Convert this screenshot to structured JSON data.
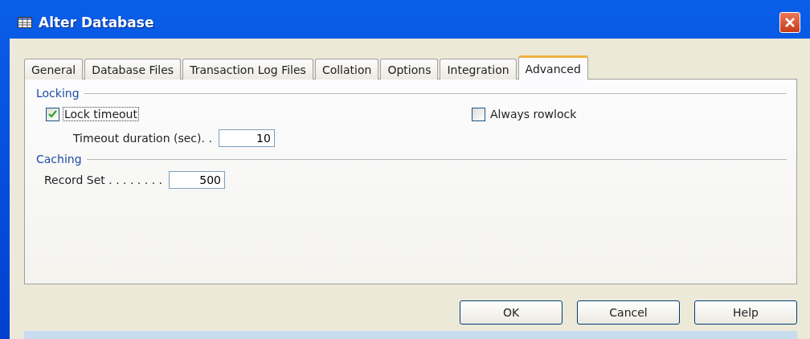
{
  "window": {
    "title": "Alter Database"
  },
  "tabs": [
    {
      "label": "General",
      "selected": false
    },
    {
      "label": "Database Files",
      "selected": false
    },
    {
      "label": "Transaction Log Files",
      "selected": false
    },
    {
      "label": "Collation",
      "selected": false
    },
    {
      "label": "Options",
      "selected": false
    },
    {
      "label": "Integration",
      "selected": false
    },
    {
      "label": "Advanced",
      "selected": true
    }
  ],
  "locking": {
    "heading": "Locking",
    "lock_timeout": {
      "label": "Lock timeout",
      "checked": true
    },
    "always_rowlock": {
      "label": "Always rowlock",
      "checked": false
    },
    "timeout_duration": {
      "label": "Timeout duration (sec). .",
      "value": "10"
    }
  },
  "caching": {
    "heading": "Caching",
    "record_set": {
      "label": "Record Set . . . . . . . .",
      "value": "500"
    }
  },
  "buttons": [
    "OK",
    "Cancel",
    "Help"
  ]
}
